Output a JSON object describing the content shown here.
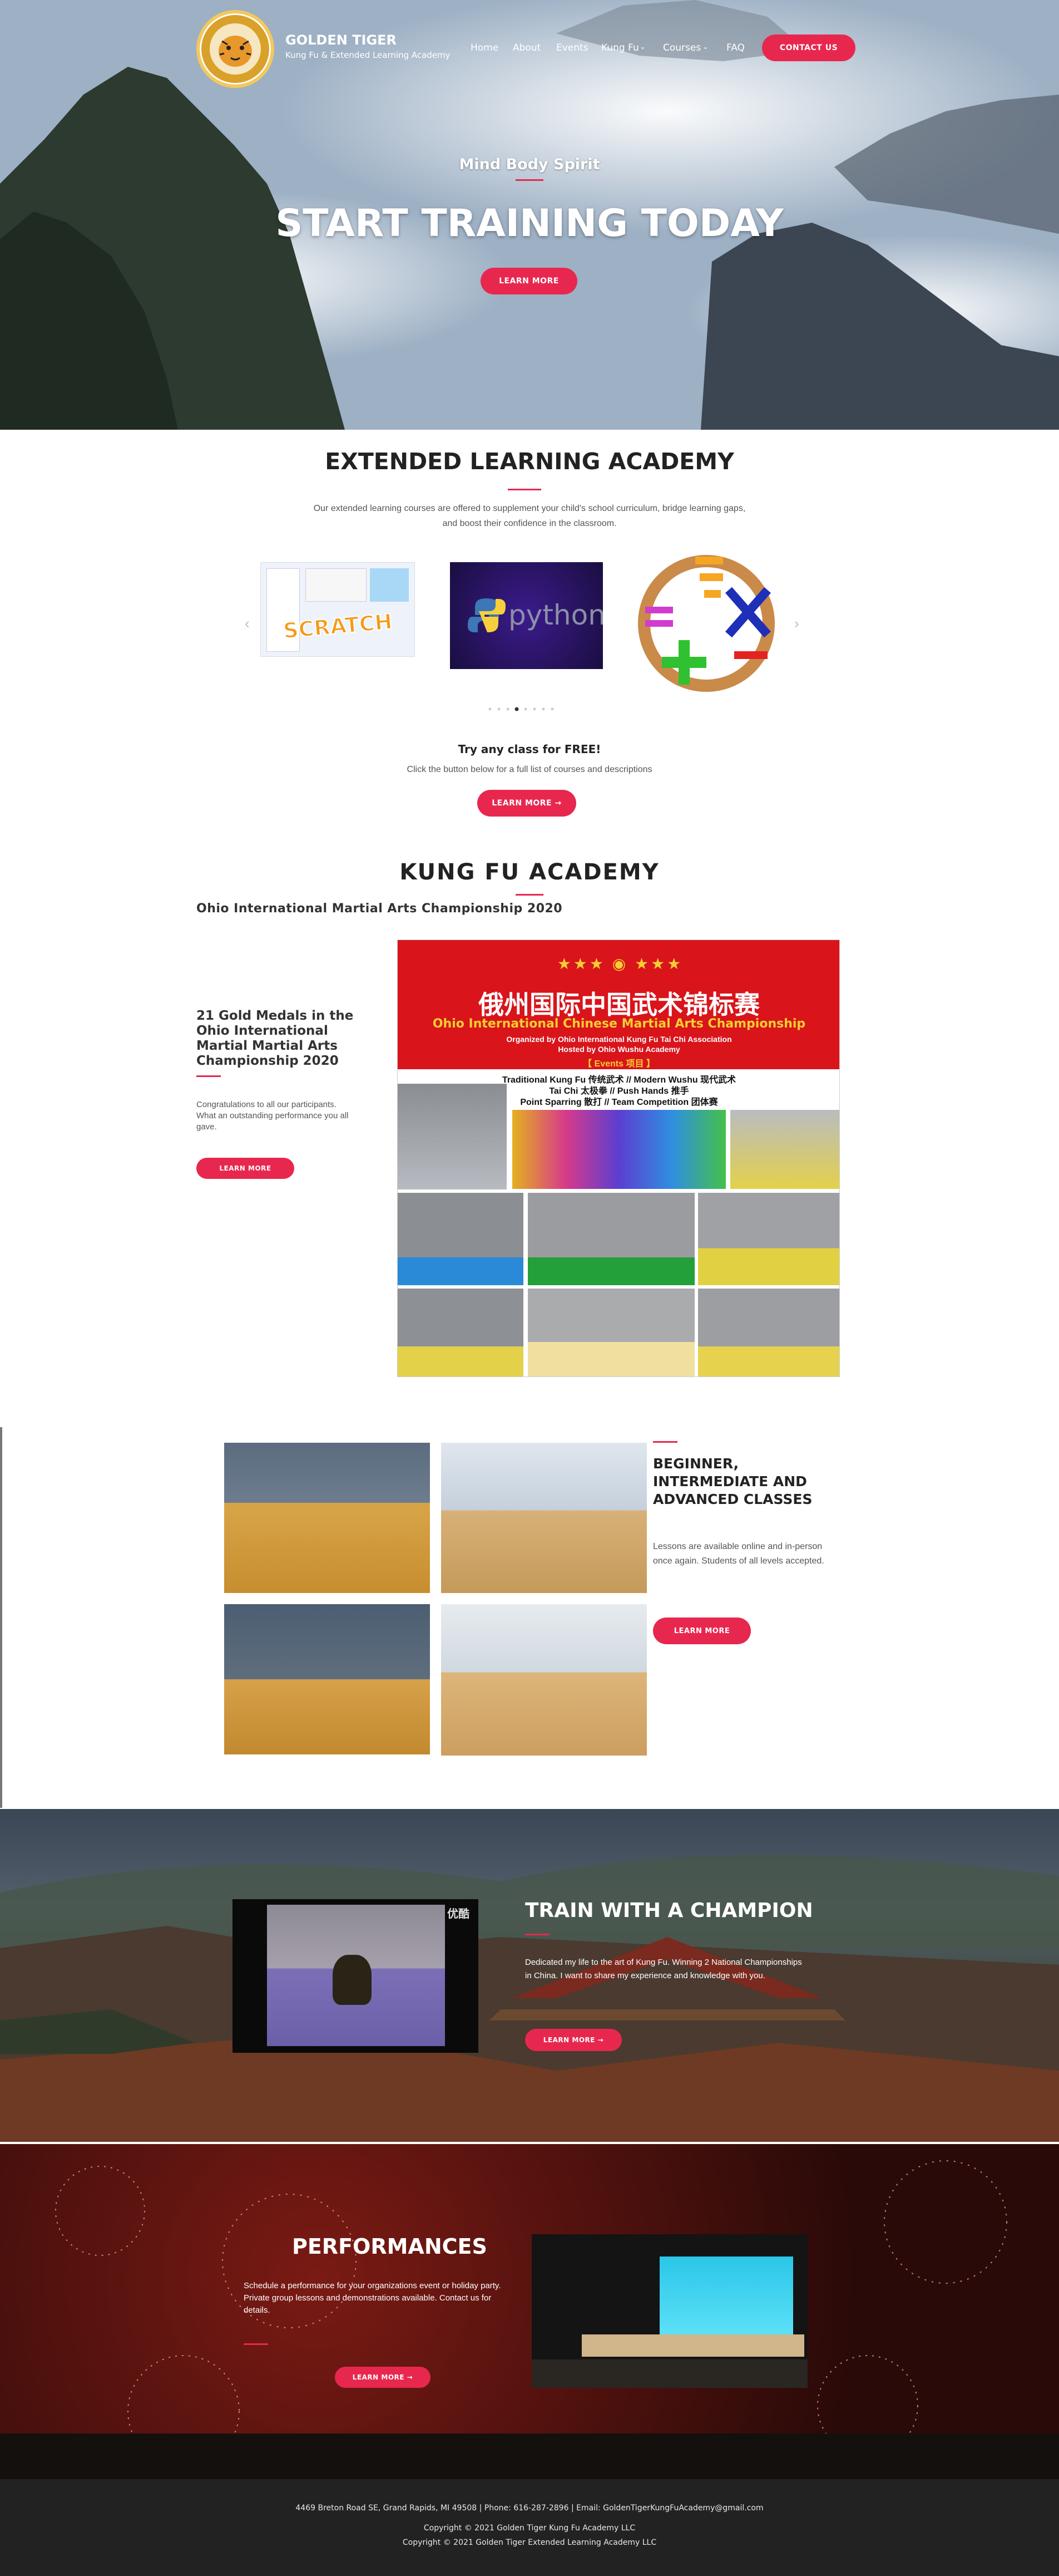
{
  "header": {
    "brand_name": "GOLDEN TIGER",
    "brand_tagline": "Kung Fu & Extended Learning Academy",
    "nav": [
      "Home",
      "About",
      "Events",
      "Kung Fu",
      "Courses",
      "FAQ"
    ],
    "contact_label": "CONTACT US"
  },
  "hero": {
    "subtitle": "Mind Body Spirit",
    "title": "START TRAINING TODAY",
    "button": "LEARN MORE"
  },
  "extended": {
    "title": "EXTENDED LEARNING ACADEMY",
    "text1": "Our extended learning courses are offered to supplement your child's school curriculum, bridge learning gaps,",
    "text2": "and boost their confidence in the classroom.",
    "slide1": "SCRATCH",
    "slide2": "python",
    "try_title": "Try any class for FREE!",
    "try_text": "Click the button below for a full list of courses and descriptions",
    "button": "LEARN MORE →"
  },
  "kungfu": {
    "title": "KUNG FU ACADEMY",
    "subtitle": "Ohio International Martial Arts Championship 2020",
    "card_title": "21 Gold Medals in the Ohio International Martial Martial Arts Championship 2020",
    "card_text": "Congratulations to all our participants. What an outstanding performance you all gave.",
    "button": "LEARN MORE",
    "poster_title_cn": "俄州国际中国武术锦标赛",
    "poster_title_en": "Ohio International Chinese Martial Arts Championship",
    "poster_org1": "Organized by Ohio International Kung Fu Tai Chi Association",
    "poster_org2": "Hosted by Ohio Wushu Academy",
    "poster_events": "【 Events 项目 】",
    "poster_line1": "Traditional Kung Fu 传统武术 // Modern Wushu 现代武术",
    "poster_line2": "Tai Chi 太极拳 // Push Hands 推手",
    "poster_line3": "Point Sparring 散打 // Team Competition 团体赛"
  },
  "classes": {
    "title": "BEGINNER, INTERMEDIATE AND ADVANCED CLASSES",
    "text": "Lessons are available online and in-person once again. Students of all levels accepted.",
    "button": "LEARN MORE"
  },
  "champion": {
    "title": "TRAIN WITH A CHAMPION",
    "text": "Dedicated my life to the art of Kung Fu. Winning 2 National Championships in China. I want to share my experience and knowledge with you.",
    "button": "LEARN MORE →",
    "video_mark": "优酷"
  },
  "performances": {
    "title": "PERFORMANCES",
    "text": "Schedule a performance for your organizations event or holiday party. Private group lessons and demonstrations available. Contact us for details.",
    "button": "LEARN MORE →"
  },
  "footer": {
    "address": "4469 Breton Road SE, Grand Rapids, MI 49508  |  Phone: 616-287-2896  |  Email: GoldenTigerKungFuAcademy@gmail.com",
    "copy1": "Copyright © 2021 Golden Tiger Kung Fu Academy LLC",
    "copy2": "Copyright © 2021 Golden Tiger Extended Learning Academy LLC"
  },
  "colors": {
    "accent": "#e8274f",
    "footer": "#222222"
  }
}
